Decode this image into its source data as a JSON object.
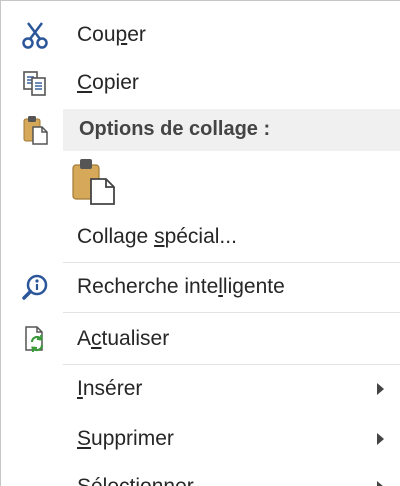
{
  "menu": {
    "cut": {
      "pre": "Cou",
      "u": "p",
      "post": "er"
    },
    "copy": {
      "pre": "",
      "u": "C",
      "post": "opier"
    },
    "paste_options": {
      "title": "Options de collage :"
    },
    "paste_special": {
      "pre": "Collage ",
      "u": "s",
      "post": "pécial..."
    },
    "smart_lookup": {
      "pre": "Recherche inte",
      "u": "l",
      "post": "ligente"
    },
    "refresh": {
      "pre": "A",
      "u": "c",
      "post": "tualiser"
    },
    "insert": {
      "pre": "",
      "u": "I",
      "post": "nsérer"
    },
    "delete": {
      "pre": "",
      "u": "S",
      "post": "upprimer"
    },
    "select": {
      "pre": "Sélectionner",
      "u": "",
      "post": ""
    }
  },
  "icons": {
    "cut": "scissors-icon",
    "copy": "copy-icon",
    "paste": "clipboard-icon",
    "smart_lookup": "lightbulb-search-icon",
    "refresh": "refresh-page-icon"
  },
  "colors": {
    "accent_blue": "#2b579a",
    "refresh_green": "#3a9a3a",
    "clipboard_tan": "#d6a85a"
  }
}
